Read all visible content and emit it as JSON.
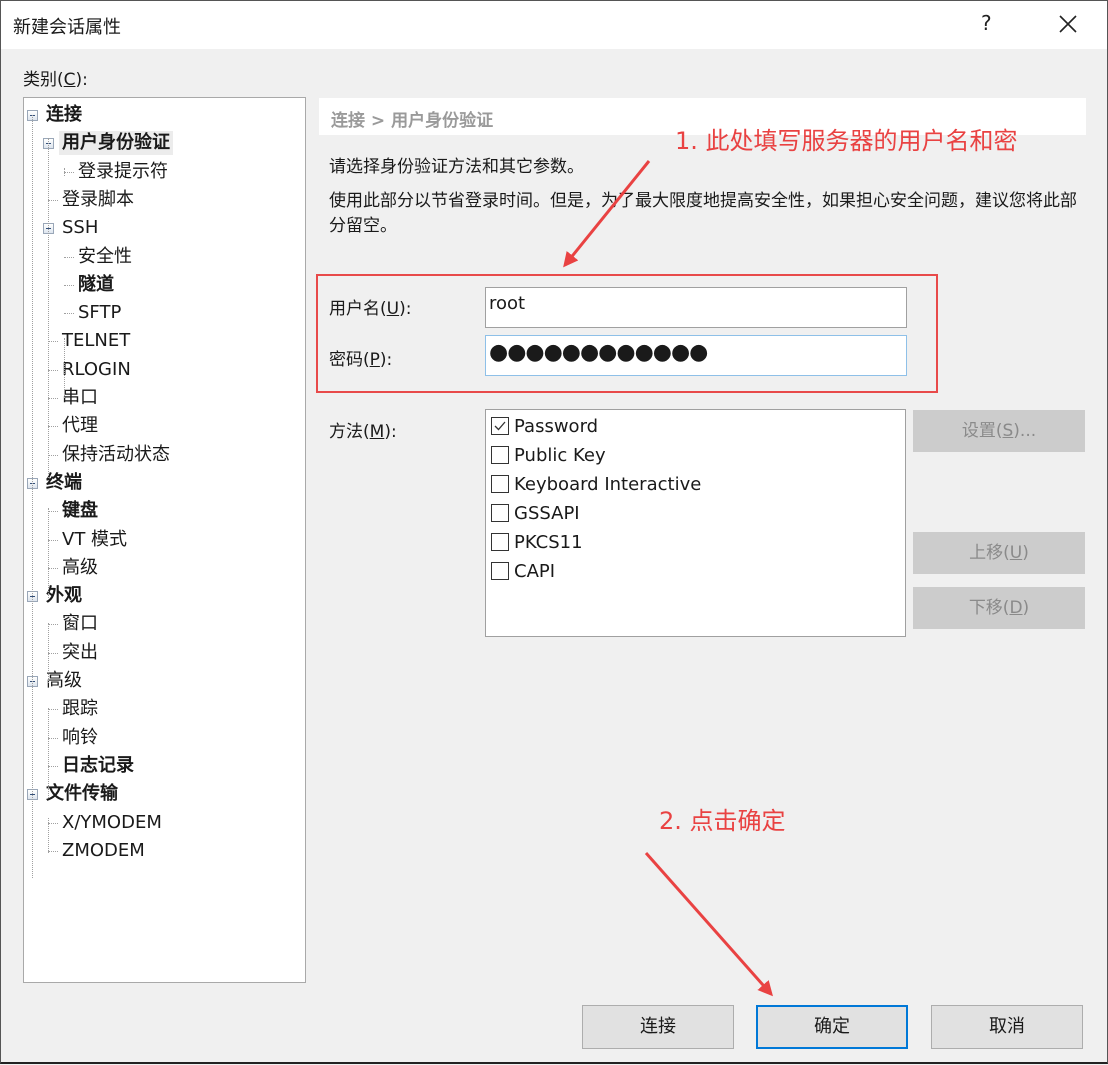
{
  "window": {
    "title": "新建会话属性",
    "help_label": "?",
    "close_icon": "close-icon"
  },
  "category": {
    "label_pre": "类别(",
    "label_key": "C",
    "label_post": "):"
  },
  "tree": [
    {
      "label": "连接",
      "level": 0,
      "bold": true,
      "expanded": true
    },
    {
      "label": "用户身份验证",
      "level": 1,
      "bold": true,
      "expanded": true,
      "selected": true
    },
    {
      "label": "登录提示符",
      "level": 2,
      "bold": false
    },
    {
      "label": "登录脚本",
      "level": 1,
      "bold": false
    },
    {
      "label": "SSH",
      "level": 1,
      "bold": false,
      "expanded": true
    },
    {
      "label": "安全性",
      "level": 2,
      "bold": false
    },
    {
      "label": "隧道",
      "level": 2,
      "bold": true
    },
    {
      "label": "SFTP",
      "level": 2,
      "bold": false
    },
    {
      "label": "TELNET",
      "level": 1,
      "bold": false
    },
    {
      "label": "RLOGIN",
      "level": 1,
      "bold": false
    },
    {
      "label": "串口",
      "level": 1,
      "bold": false
    },
    {
      "label": "代理",
      "level": 1,
      "bold": false
    },
    {
      "label": "保持活动状态",
      "level": 1,
      "bold": false
    },
    {
      "label": "终端",
      "level": 0,
      "bold": true,
      "expanded": true
    },
    {
      "label": "键盘",
      "level": 1,
      "bold": true
    },
    {
      "label": "VT 模式",
      "level": 1,
      "bold": false
    },
    {
      "label": "高级",
      "level": 1,
      "bold": false
    },
    {
      "label": "外观",
      "level": 0,
      "bold": true,
      "expanded": true
    },
    {
      "label": "窗口",
      "level": 1,
      "bold": false
    },
    {
      "label": "突出",
      "level": 1,
      "bold": false
    },
    {
      "label": "高级",
      "level": 0,
      "bold": false,
      "expanded": true
    },
    {
      "label": "跟踪",
      "level": 1,
      "bold": false
    },
    {
      "label": "响铃",
      "level": 1,
      "bold": false
    },
    {
      "label": "日志记录",
      "level": 1,
      "bold": true
    },
    {
      "label": "文件传输",
      "level": 0,
      "bold": true,
      "expanded": true
    },
    {
      "label": "X/YMODEM",
      "level": 1,
      "bold": false
    },
    {
      "label": "ZMODEM",
      "level": 1,
      "bold": false
    }
  ],
  "panel": {
    "breadcrumb": "连接 > 用户身份验证",
    "description1": "请选择身份验证方法和其它参数。",
    "description2": "使用此部分以节省登录时间。但是，为了最大限度地提高安全性，如果担心安全问题，建议您将此部分留空。",
    "username": {
      "label_pre": "用户名(",
      "label_key": "U",
      "label_post": "):",
      "value": "root"
    },
    "password": {
      "label_pre": "密码(",
      "label_key": "P",
      "label_post": "):",
      "masked_value": "●●●●●●●●●●●●"
    },
    "method": {
      "label_pre": "方法(",
      "label_key": "M",
      "label_post": "):"
    },
    "methods": [
      {
        "label": "Password",
        "checked": true
      },
      {
        "label": "Public Key",
        "checked": false
      },
      {
        "label": "Keyboard Interactive",
        "checked": false
      },
      {
        "label": "GSSAPI",
        "checked": false
      },
      {
        "label": "PKCS11",
        "checked": false
      },
      {
        "label": "CAPI",
        "checked": false
      }
    ],
    "settings_button": {
      "pre": "设置(",
      "key": "S",
      "post": ")..."
    },
    "move_up_button": {
      "pre": "上移(",
      "key": "U",
      "post": ")"
    },
    "move_down_button": {
      "pre": "下移(",
      "key": "D",
      "post": ")"
    }
  },
  "footer": {
    "connect": "连接",
    "ok": "确定",
    "cancel": "取消"
  },
  "annotations": {
    "step1": "1. 此处填写服务器的用户名和密",
    "step2": "2. 点击确定",
    "color": "#e94242"
  },
  "colors": {
    "highlight_border": "#e84a4a",
    "default_button_border": "#0078d7",
    "disabled_button_bg": "#cccccc"
  }
}
